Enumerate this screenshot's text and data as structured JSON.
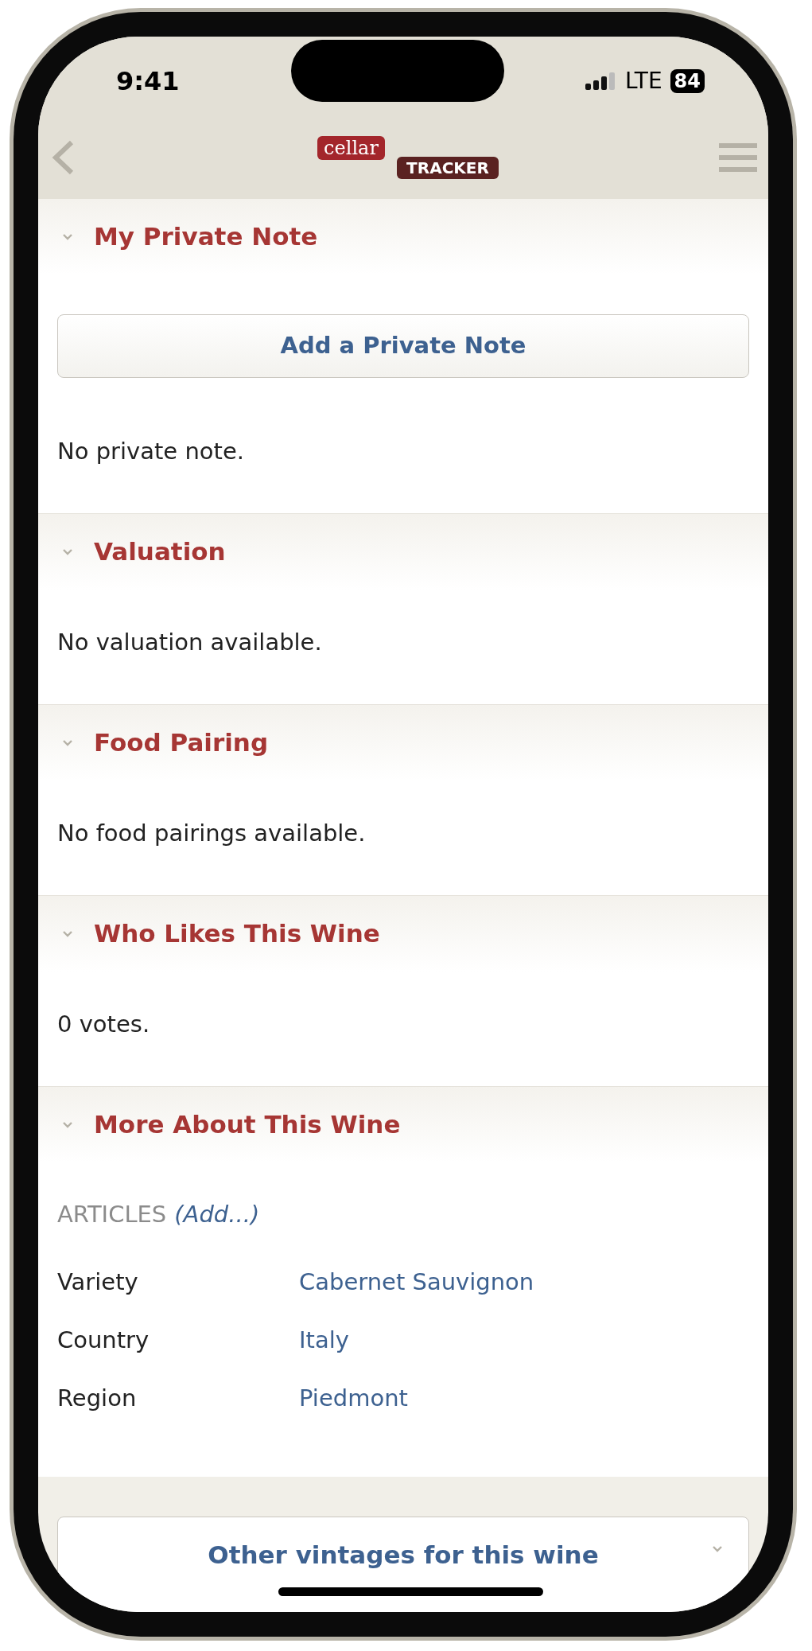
{
  "status_bar": {
    "time": "9:41",
    "network": "LTE",
    "battery": "84"
  },
  "header": {
    "logo": [
      "cellar",
      "TRACKER"
    ]
  },
  "sections": [
    {
      "title": "My Private Note",
      "expanded": true,
      "button": "Add a Private Note",
      "text": "No private note."
    },
    {
      "title": "Valuation",
      "expanded": true,
      "text": "No valuation available."
    },
    {
      "title": "Food Pairing",
      "expanded": true,
      "text": "No food pairings available."
    },
    {
      "title": "Who Likes This Wine",
      "expanded": true,
      "text": "0 votes."
    },
    {
      "title": "More About This Wine",
      "expanded": true,
      "articles_label": "ARTICLES",
      "articles_link": "(Add...)",
      "details": [
        {
          "label": "Variety",
          "value": "Cabernet Sauvignon"
        },
        {
          "label": "Country",
          "value": "Italy"
        },
        {
          "label": "Region",
          "value": "Piedmont"
        }
      ]
    }
  ],
  "footer_button": {
    "label": "Other vintages for this wine"
  }
}
